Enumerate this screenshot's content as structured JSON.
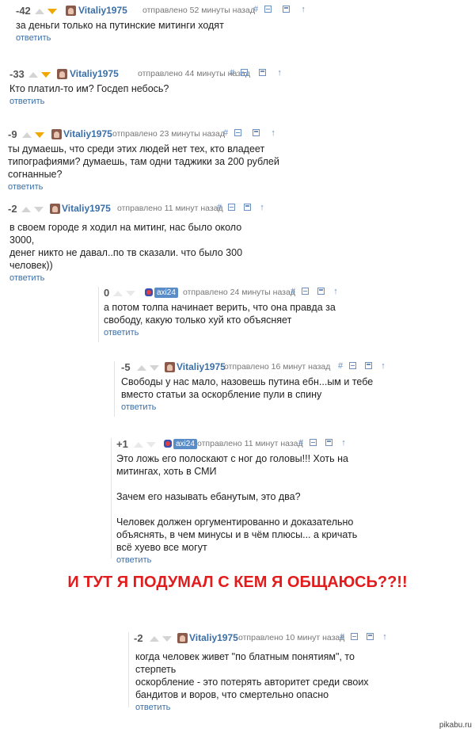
{
  "comments": [
    {
      "score": "-42",
      "user": "Vitaliy1975",
      "sent": "отправлено 52 минуты назад",
      "text": "за деньги только на путинские митинги ходят",
      "reply": "ответить"
    },
    {
      "score": "-33",
      "user": "Vitaliy1975",
      "sent": "отправлено 44 минуты назад",
      "text": "Кто платил-то им? Госдеп небось?",
      "reply": "ответить"
    },
    {
      "score": "-9",
      "user": "Vitaliy1975",
      "sent": "отправлено 23 минуты назад",
      "text": "ты думаешь, что среди этих людей нет тех, кто владеет\nтипографиями? думаешь, там одни таджики за 200 рублей\nсогнанные?",
      "reply": "ответить"
    },
    {
      "score": "-2",
      "user": "Vitaliy1975",
      "sent": "отправлено 11 минут назад",
      "text": "в своем городе я ходил на митинг, нас было около 3000,\nденег никто не давал..по тв сказали. что было 300\nчеловек))",
      "reply": "ответить"
    },
    {
      "score": "0",
      "user": "axi24",
      "sent": "отправлено 24 минуты назад",
      "text": "а потом толпа начинает верить, что она правда за\nсвободу, какую только хуй кто объясняет",
      "reply": "ответить"
    },
    {
      "score": "-5",
      "user": "Vitaliy1975",
      "sent": "отправлено 16 минут назад",
      "text": "Свободы у нас мало, назовешь путина ебн...ым и тебе\nвместо статьи за оскорбление пули в спину",
      "reply": "ответить"
    },
    {
      "score": "+1",
      "user": "axi24",
      "sent": "отправлено 11 минут назад",
      "text": "Это ложь его полоскают с ног до головы!!! Хоть на\nмитингах, хоть в СМИ\n\nЗачем его называть ебанутым, это два?\n\nЧеловек должен оргументированно и доказательно\nобъяснять, в чем минусы и в чём плюсы... а кричать\nвсё хуево все могут",
      "reply": "ответить"
    },
    {
      "score": "-2",
      "user": "Vitaliy1975",
      "sent": "отправлено 10 минут назад",
      "text": "когда человек живет \"по блатным понятиям\", то стерпеть\nоскорбление - это потерять авторитет среди своих\nбандитов и воров, что смертельно опасно",
      "reply": "ответить"
    }
  ],
  "tools": {
    "hash": "#",
    "up": "↑"
  },
  "banner": "И ТУТ Я ПОДУМАЛ С КЕМ Я ОБЩАЮСЬ??!!",
  "watermark": "pikabu.ru",
  "colors": {
    "accent": "#3a6fa8",
    "highlight": "#fdfad4",
    "banner": "#e21c1c",
    "downvoted": "#f0a800"
  }
}
